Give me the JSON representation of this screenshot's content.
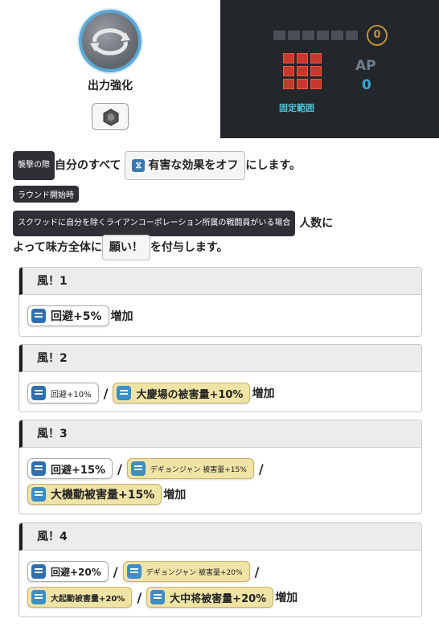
{
  "skill": {
    "name": "出力強化",
    "icon": "refresh-arrows-icon",
    "upgrade_icon": "hexagon-icon"
  },
  "range": {
    "label": "固定範囲",
    "ap_label": "AP",
    "ap_value": "0",
    "cost_icon_text": "0",
    "colors": {
      "grid": "#c7392d",
      "ap": "#3aa7cf",
      "bg": "#23262b"
    }
  },
  "desc": {
    "tag_attack": "襲撃の際",
    "text1a": "自分のすべて",
    "chip_debuff": "有害な効果をオフ",
    "text1b": "にします。",
    "tag_round": "ラウンド開始時",
    "tag_condition": "スクワッドに自分を除くライアンコーポレーション所属の戦闘員がいる場合",
    "text2a": "人数に",
    "text3a": "よって味方全体に",
    "chip_buff": "願い！",
    "text3b": "を付与します。"
  },
  "levels": [
    {
      "title": "風！1",
      "stats": [
        [
          "回避+5%"
        ]
      ],
      "tail": "増加"
    },
    {
      "title": "風！2",
      "stats": [
        [
          "回避+10%",
          "大慶場の被害量+10%"
        ]
      ],
      "tail": "増加"
    },
    {
      "title": "風！3",
      "stats": [
        [
          "回避+15%",
          "デギョンジャン 被害量+15%"
        ],
        [
          "大機動被害量+15%"
        ]
      ],
      "tail": "増加"
    },
    {
      "title": "風！4",
      "stats": [
        [
          "回避+20%",
          "デギョンジャン 被害量+20%"
        ],
        [
          "大起動被害量+20%",
          "大中将被害量+20%"
        ]
      ],
      "tail": "増加"
    }
  ]
}
